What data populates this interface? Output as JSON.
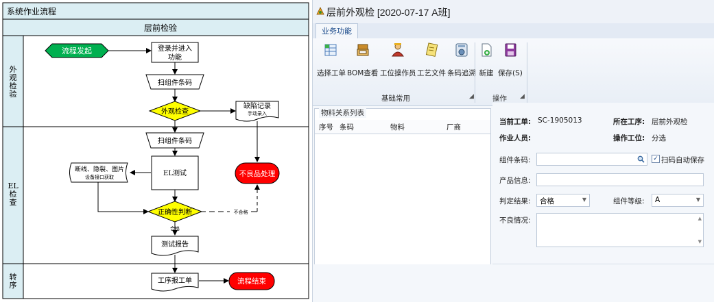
{
  "flowchart": {
    "title": "系统作业流程",
    "column_header": "层前检验",
    "lanes": [
      {
        "label": "外观检验"
      },
      {
        "label": "EL检查"
      },
      {
        "label": "转序"
      }
    ],
    "nodes": {
      "start": "流程发起",
      "login_line1": "登录并进入",
      "login_line2": "功能",
      "scan1": "扫组件条码",
      "visual_check": "外观检查",
      "defect_line1": "缺陷记录",
      "defect_line2": "手动录入",
      "scan2": "扫组件条码",
      "el_test": "EL测试",
      "io_line1": "断线、隐裂、图片",
      "io_line2": "设备接口获取",
      "ng_handle": "不良品处理",
      "judge": "正确性判断",
      "fail_label": "不合格",
      "pass_label": "合格",
      "report": "测试报告",
      "transfer": "工序报工单",
      "end": "流程结束"
    }
  },
  "app": {
    "title": "层前外观检 [2020-07-17 A班]",
    "tab": "业务功能",
    "ribbon": {
      "group1_label": "基础常用",
      "group2_label": "操作",
      "buttons": [
        {
          "label": "选择工单",
          "icon": "select-order-icon"
        },
        {
          "label": "BOM查看",
          "icon": "bom-icon"
        },
        {
          "label": "工位操作员",
          "icon": "operator-icon"
        },
        {
          "label": "工艺文件",
          "icon": "document-icon"
        },
        {
          "label": "条码追溯",
          "icon": "trace-icon"
        },
        {
          "label": "新建",
          "icon": "new-icon"
        },
        {
          "label": "保存(S)",
          "icon": "save-icon"
        }
      ]
    },
    "list": {
      "caption": "物料关系列表",
      "columns": [
        "序号",
        "条码",
        "物料",
        "厂商"
      ]
    },
    "form": {
      "order_label": "当前工单:",
      "order_value": "SC-1905013",
      "process_label": "所在工序:",
      "process_value": "层前外观检",
      "worker_label": "作业人员:",
      "station_label": "操作工位:",
      "station_value": "分选",
      "barcode_label": "组件条码:",
      "autosave_label": "扫码自动保存",
      "product_label": "产品信息:",
      "result_label": "判定结果:",
      "result_value": "合格",
      "grade_label": "组件等级:",
      "grade_value": "A",
      "defect_label": "不良情况:"
    }
  }
}
